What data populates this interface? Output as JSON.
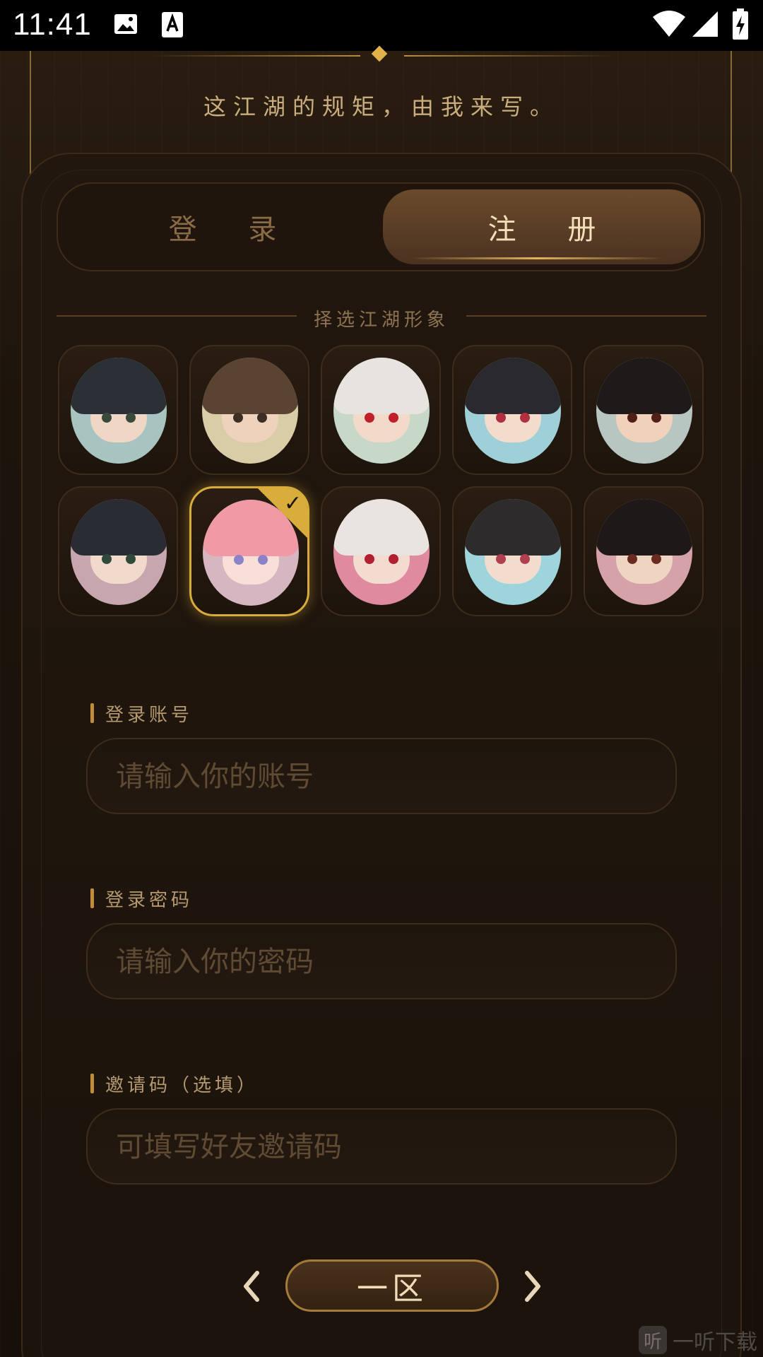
{
  "status_bar": {
    "time": "11:41"
  },
  "header": {
    "slogan": "这江湖的规矩，由我来写。"
  },
  "tabs": {
    "login_label": "登 录",
    "register_label": "注 册",
    "active": "register"
  },
  "avatar_section": {
    "title": "择选江湖形象",
    "selected_index": 6,
    "avatars": [
      {
        "hair": "#2b2f36",
        "skin": "#f0d6c4",
        "eye": "#3a4a3a",
        "bg": "#a8c4c0"
      },
      {
        "hair": "#5a4330",
        "skin": "#efd2bb",
        "eye": "#3b2f25",
        "bg": "#d9cda8"
      },
      {
        "hair": "#e7e3df",
        "skin": "#f2d9c9",
        "eye": "#c0202a",
        "bg": "#c8d8c8"
      },
      {
        "hair": "#2a2a2e",
        "skin": "#f3dccc",
        "eye": "#b03040",
        "bg": "#9fd0d8"
      },
      {
        "hair": "#1f1a1a",
        "skin": "#f0d2bc",
        "eye": "#502018",
        "bg": "#b7c6c0"
      },
      {
        "hair": "#2a2c33",
        "skin": "#f1dacb",
        "eye": "#2f4a3a",
        "bg": "#c8a6b0"
      },
      {
        "hair": "#ef9aa4",
        "skin": "#f8e0d8",
        "eye": "#8c82c8",
        "bg": "#d6b6c0"
      },
      {
        "hair": "#e9e4e0",
        "skin": "#f4dbd0",
        "eye": "#b02030",
        "bg": "#e08aa0"
      },
      {
        "hair": "#2d2b2b",
        "skin": "#f2dcce",
        "eye": "#b04050",
        "bg": "#9ed4dc"
      },
      {
        "hair": "#1e1818",
        "skin": "#f0d4c2",
        "eye": "#6a2a20",
        "bg": "#d4a2a8"
      }
    ]
  },
  "form": {
    "account": {
      "label": "登录账号",
      "placeholder": "请输入你的账号",
      "value": ""
    },
    "password": {
      "label": "登录密码",
      "placeholder": "请输入你的密码",
      "value": ""
    },
    "invite": {
      "label": "邀请码（选填）",
      "placeholder": "可填写好友邀请码",
      "value": ""
    }
  },
  "server": {
    "name": "一区"
  },
  "watermark": {
    "logo_char": "听",
    "text": "一听下载"
  },
  "colors": {
    "accent_gold": "#d8ab3a",
    "tab_active_text": "#f3dfb9",
    "background": "#1a120b"
  }
}
